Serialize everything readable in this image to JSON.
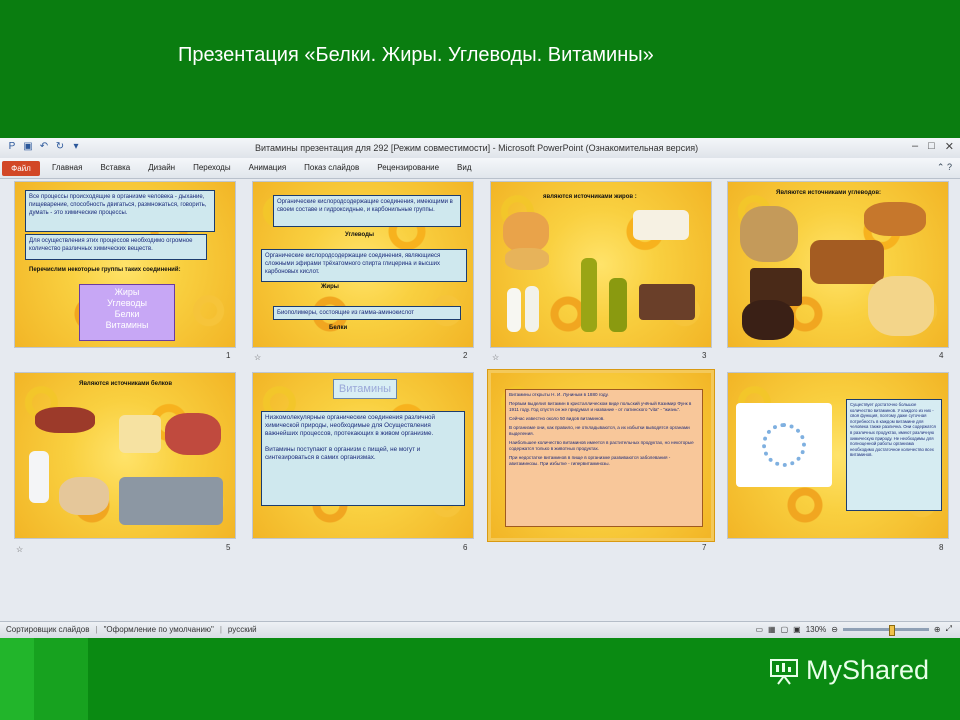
{
  "page": {
    "heading": "Презентация «Белки. Жиры. Углеводы. Витамины»"
  },
  "window": {
    "title": "Витамины презентация для 292 [Режим совместимости] - Microsoft PowerPoint (Ознакомительная версия)"
  },
  "ribbon": {
    "file": "Файл",
    "tabs": [
      "Главная",
      "Вставка",
      "Дизайн",
      "Переходы",
      "Анимация",
      "Показ слайдов",
      "Рецензирование",
      "Вид"
    ]
  },
  "slides": [
    {
      "number": "1",
      "box1": "Все процессы происходящие в организме человека - дыхание, пищеварение, способность двигаться, размножаться, говорить, думать - это химические процессы.",
      "box2": "Для осуществления этих процессов необходимо огромное количество различных химических веществ.",
      "caption": "Перечислим некоторые группы таких соединений:",
      "list": [
        "Жиры",
        "Углеводы",
        "Белки",
        "Витамины"
      ]
    },
    {
      "number": "2",
      "box1": "Органические кислородсодержащие соединения, имеющими в своем составе и гидроксидные, и карбонильные группы.",
      "lbl1": "Углеводы",
      "box2": "Органические кислородсодержащие соединения, являющиеся сложными эфирами трёхатомного спирта глицерина и высших карбоновых кислот.",
      "lbl2": "Жиры",
      "box3": "Биополимеры, состоящие из гамма-аминокислот",
      "lbl3": "Белки"
    },
    {
      "number": "3",
      "caption": "являются источниками жиров :"
    },
    {
      "number": "4",
      "caption": "Являются источниками углеводов:"
    },
    {
      "number": "5",
      "caption": "Являются источниками белков"
    },
    {
      "number": "6",
      "title": "Витамины",
      "box": "Низкомолекулярные органические соединения различной химической природы, необходимые для Осуществления важнейших процессов, протекающих в живом организме.",
      "box2": "Витамины поступают в организм с пищей, не могут и синтезироваться в самих организмах."
    },
    {
      "number": "7",
      "bullets": [
        "Витамины открыты Н. И. Луниным в 1880 году.",
        "Первым выделил витамин в кристаллическом виде польский учёный Казимир Функ в 1911 году. Год спустя он же придумал и название - от латинского \"vita\" - \"жизнь\".",
        "Сейчас известно около 50 видов витаминов.",
        "В организме они, как правило, не откладываются, а их избытки выводятся органами выделения.",
        "Наибольшее количество витаминов имеется в растительных продуктах, но некоторые содержатся только в животных продуктах.",
        "При недостатке витаминов в пище в организме развиваются заболевания - авитаминозы. При избытке - гипервитаминозы."
      ]
    },
    {
      "number": "8",
      "text": "Существует достаточно большое количество витаминов. У каждого из них - своя функция, поэтому даже суточная потребность в каждом витамине для человека также различна. Они содержатся в различных продуктах, имеют различную химическую природу. Не необходимы для полноценной работы организма необходимо достаточное количество всех витаминов."
    }
  ],
  "status": {
    "view": "Сортировщик слайдов",
    "theme": "\"Оформление по умолчанию\"",
    "lang": "русский",
    "zoom": "130%",
    "zoom_level": 0.56
  },
  "logo": {
    "text": "MyShared"
  }
}
